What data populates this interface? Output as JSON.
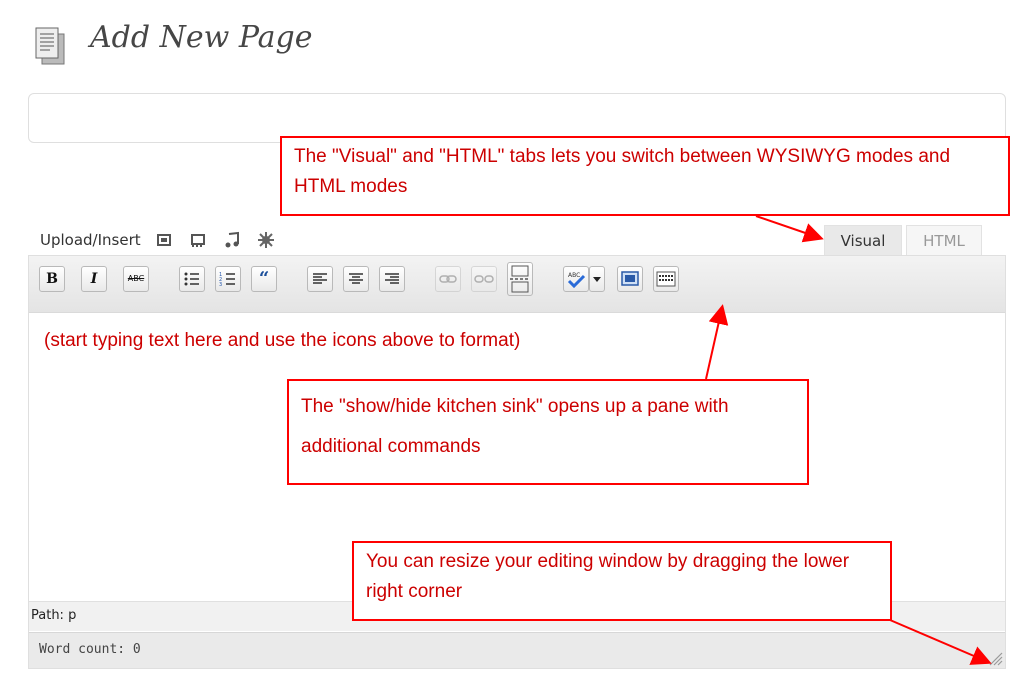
{
  "header": {
    "title": "Add New Page",
    "icon": "page-icon"
  },
  "title_field": {
    "value": "",
    "placeholder": ""
  },
  "media": {
    "label": "Upload/Insert",
    "icons": [
      "image-icon",
      "video-icon",
      "audio-icon",
      "media-icon"
    ]
  },
  "tabs": [
    {
      "label": "Visual",
      "active": true
    },
    {
      "label": "HTML",
      "active": false
    }
  ],
  "toolbar": {
    "buttons": [
      {
        "name": "bold",
        "glyph": "B"
      },
      {
        "name": "italic",
        "glyph": "I"
      },
      {
        "name": "strikethrough",
        "glyph": "ABC"
      },
      {
        "name": "bullet-list",
        "glyph": ""
      },
      {
        "name": "numbered-list",
        "glyph": ""
      },
      {
        "name": "blockquote",
        "glyph": "“"
      },
      {
        "name": "align-left",
        "glyph": ""
      },
      {
        "name": "align-center",
        "glyph": ""
      },
      {
        "name": "align-right",
        "glyph": ""
      },
      {
        "name": "insert-link",
        "glyph": ""
      },
      {
        "name": "unlink",
        "glyph": ""
      },
      {
        "name": "insert-more",
        "glyph": ""
      },
      {
        "name": "spellcheck",
        "glyph": ""
      },
      {
        "name": "fullscreen",
        "glyph": ""
      },
      {
        "name": "kitchen-sink",
        "glyph": ""
      }
    ]
  },
  "editor": {
    "hint": "(start typing text here and use the icons above to format)"
  },
  "status": {
    "path": "Path: p",
    "word_count": "Word count: 0"
  },
  "annotations": {
    "tabs": "The \"Visual\" and \"HTML\" tabs lets you switch between WYSIWYG modes and HTML modes",
    "kitchen_sink": "The \"show/hide kitchen sink\" opens up a pane with additional commands",
    "resize": "You can resize your editing window by dragging the lower right corner"
  },
  "colors": {
    "annotation": "#ff0000",
    "annotation_text": "#cc0000",
    "toolbar_bg": "#e9e9e9"
  }
}
